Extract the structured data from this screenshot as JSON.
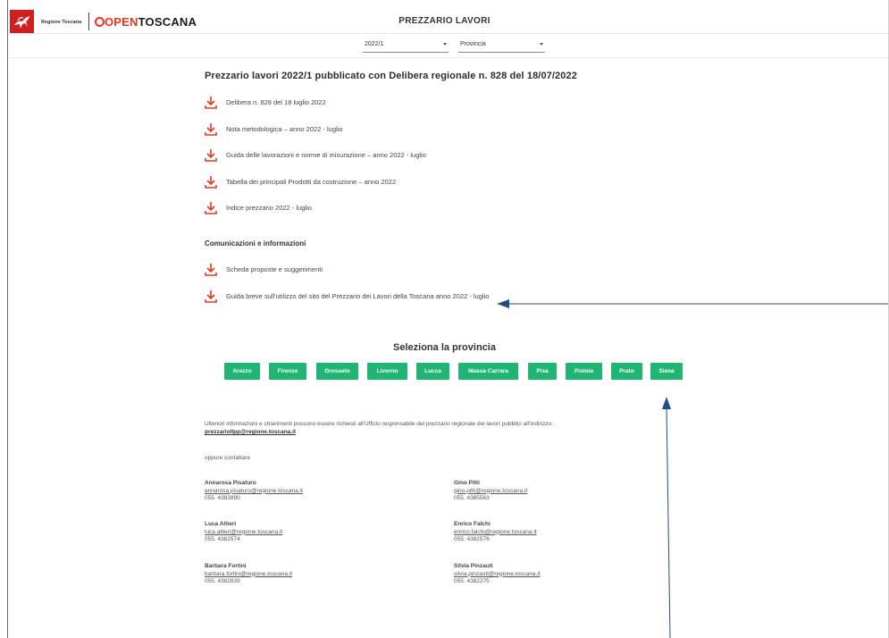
{
  "header": {
    "region_name": "Regione Toscana",
    "brand_open": "OPEN",
    "brand_toscana": "TOSCANA",
    "app_title": "PREZZARIO LAVORI"
  },
  "filters": {
    "year": "2022/1",
    "province": "Provincia"
  },
  "main": {
    "title": "Prezzario lavori 2022/1 pubblicato con Delibera regionale n. 828 del 18/07/2022",
    "documents": [
      "Delibera n. 828 del 18 luglio 2022",
      "Nota metodologica – anno 2022 - luglio",
      "Guida delle lavorazioni e norme di misurazione – anno 2022 - luglio",
      "Tabella dei principali Prodotti da costruzione – anno 2022",
      "Indice prezzario 2022 - luglio"
    ],
    "communications_title": "Comunicazioni e informazioni",
    "communications": [
      "Scheda proposte e suggerimenti",
      "Guida breve sull'utilizzo del sito del Prezzario dei Lavori della Toscana anno 2022 - luglio"
    ]
  },
  "provinces": {
    "title": "Seleziona la provincia",
    "items": [
      "Arezzo",
      "Firenze",
      "Grosseto",
      "Livorno",
      "Lucca",
      "Massa Carrara",
      "Pisa",
      "Pistoia",
      "Prato",
      "Siena"
    ]
  },
  "info": {
    "text": "Ulteriori informazioni e chiarimenti possono essere richiesti all'Ufficio responsabile del prezzario regionale dei lavori pubblici all'indirizzo:",
    "email": "prezzariollpp@regione.toscana.it",
    "or_contact": "oppure contattare"
  },
  "contacts": [
    {
      "name": "Annarosa Pisaturo",
      "email": "annarosa.pisaturo@regione.toscana.it",
      "phone": "055. 4383890"
    },
    {
      "name": "Gino Pitti",
      "email": "gino.pitti@regione.toscana.it",
      "phone": "055. 4385563"
    },
    {
      "name": "Luca Altieri",
      "email": "luca.altieri@regione.toscana.it",
      "phone": "055. 4382574"
    },
    {
      "name": "Enrico Falchi",
      "email": "enrico.falchi@regione.toscana.it",
      "phone": "055. 4382576"
    },
    {
      "name": "Barbara Fortini",
      "email": "barbara.fortini@regione.toscana.it",
      "phone": "055. 4382839"
    },
    {
      "name": "Silvia Pinzauti",
      "email": "silvia.pinzauti@regione.toscana.it",
      "phone": "055. 4382275"
    }
  ],
  "colors": {
    "accent": "#e8381b",
    "province_button": "#21b573",
    "annotation_arrow": "#1f4e8c"
  }
}
